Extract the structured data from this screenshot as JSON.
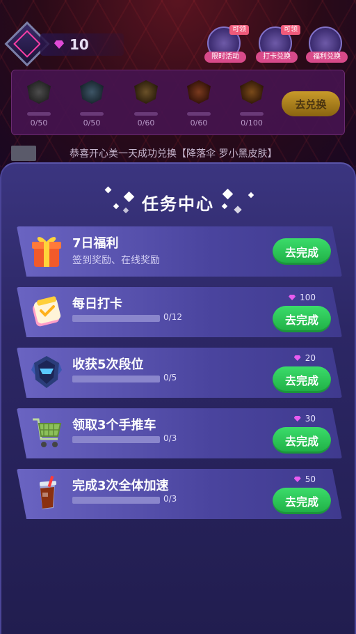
{
  "top": {
    "gem_count": "10",
    "icons": [
      {
        "label": "限时活动",
        "badge": "可领",
        "icon": "event-icon"
      },
      {
        "label": "打卡兑换",
        "badge": "可领",
        "icon": "checkin-redeem-icon"
      },
      {
        "label": "福利兑换",
        "badge": "",
        "icon": "welfare-redeem-icon"
      }
    ]
  },
  "rank_panel": {
    "slots": [
      {
        "progress": "0/50"
      },
      {
        "progress": "0/50"
      },
      {
        "progress": "0/60"
      },
      {
        "progress": "0/60"
      },
      {
        "progress": "0/100"
      }
    ],
    "redeem_label": "去兑换"
  },
  "ticker": {
    "text": "恭喜开心美一天成功兑换【降落伞 罗小黑皮肤】"
  },
  "modal": {
    "title": "任务中心",
    "tasks": [
      {
        "title": "7日福利",
        "subtitle": "签到奖励、在线奖励",
        "progress": "",
        "reward": "",
        "fill": 0,
        "button": "去完成",
        "icon": "gift-box-icon"
      },
      {
        "title": "每日打卡",
        "subtitle": "",
        "progress": "0/12",
        "reward": "100",
        "fill": 0,
        "button": "去完成",
        "icon": "checklist-icon"
      },
      {
        "title": "收获5次段位",
        "subtitle": "",
        "progress": "0/5",
        "reward": "20",
        "fill": 0,
        "button": "去完成",
        "icon": "rank-helmet-icon"
      },
      {
        "title": "领取3个手推车",
        "subtitle": "",
        "progress": "0/3",
        "reward": "30",
        "fill": 0,
        "button": "去完成",
        "icon": "shopping-cart-icon"
      },
      {
        "title": "完成3次全体加速",
        "subtitle": "",
        "progress": "0/3",
        "reward": "50",
        "fill": 0,
        "button": "去完成",
        "icon": "drink-cup-icon"
      }
    ]
  },
  "colors": {
    "modal_bg": "#2c2765",
    "card_bg": "#5a54b2",
    "button_green": "#2cc257",
    "gem_pink": "#e85cf0"
  }
}
